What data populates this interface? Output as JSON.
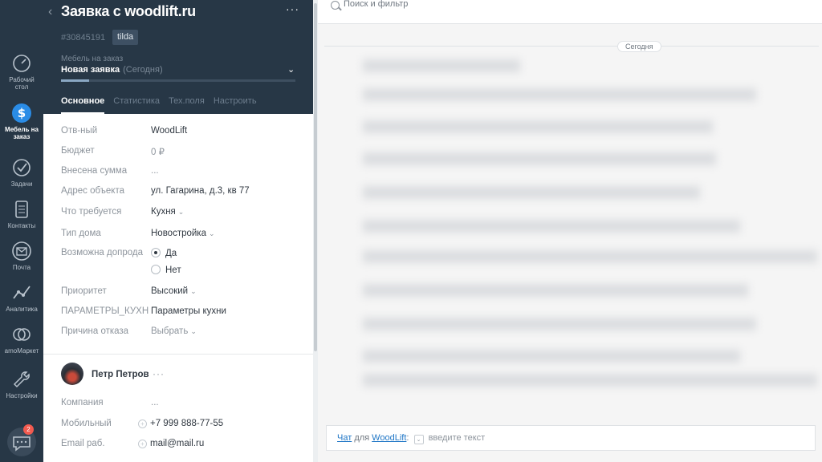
{
  "nav": {
    "items": [
      {
        "label_lines": [
          "Рабочий",
          "стол"
        ],
        "icon": "speedometer-icon"
      },
      {
        "label_lines": [
          "Мебель на",
          "заказ"
        ],
        "icon": "dollar-icon",
        "active": true
      },
      {
        "label_lines": [
          "Задачи"
        ],
        "icon": "checkmark-icon"
      },
      {
        "label_lines": [
          "Контакты"
        ],
        "icon": "contacts-icon"
      },
      {
        "label_lines": [
          "Почта"
        ],
        "icon": "mail-icon"
      },
      {
        "label_lines": [
          "Аналитика"
        ],
        "icon": "analytics-icon"
      },
      {
        "label_lines": [
          "amoМаркет"
        ],
        "icon": "market-icon"
      },
      {
        "label_lines": [
          "Настройки"
        ],
        "icon": "wrench-icon"
      }
    ],
    "chat_badge": "2"
  },
  "card": {
    "title": "Заявка с woodlift.ru",
    "more": "···",
    "id": "#30845191",
    "tag": "tilda",
    "pipeline": "Мебель на заказ",
    "stage": "Новая заявка",
    "stage_date": "(Сегодня)",
    "stage_progress": 0.12,
    "tabs": [
      "Основное",
      "Статистика",
      "Тех.поля",
      "Настроить"
    ]
  },
  "fields": {
    "responsible": {
      "label": "Отв-ный",
      "value": "WoodLift"
    },
    "budget": {
      "label": "Бюджет",
      "value": "0 ₽"
    },
    "paid": {
      "label": "Внесена сумма",
      "value": "..."
    },
    "address": {
      "label": "Адрес объекта",
      "value": "ул. Гагарина, д.3, кв 77"
    },
    "required": {
      "label": "Что требуется",
      "value": "Кухня"
    },
    "house_type": {
      "label": "Тип дома",
      "value": "Новостройка"
    },
    "extra_order": {
      "label": "Возможна допрода",
      "option_yes": "Да",
      "option_no": "Нет",
      "selected": "Да"
    },
    "priority": {
      "label": "Приоритет",
      "value": "Высокий"
    },
    "kitchen_params": {
      "label": "ПАРАМЕТРЫ_КУХН",
      "value": "Параметры кухни"
    },
    "reject_reason": {
      "label": "Причина отказа",
      "value": "Выбрать"
    }
  },
  "contact": {
    "name": "Петр Петров",
    "more": "···",
    "company": {
      "label": "Компания",
      "value": "..."
    },
    "mobile": {
      "label": "Мобильный",
      "value": "+7 999 888-77-55"
    },
    "email": {
      "label": "Email раб.",
      "value": "mail@mail.ru"
    }
  },
  "feed": {
    "search_placeholder": "Поиск и фильтр",
    "today": "Сегодня",
    "composer": {
      "chat": "Чат",
      "for": "для",
      "target": "WoodLift",
      "colon": ":",
      "placeholder": "введите текст"
    }
  }
}
